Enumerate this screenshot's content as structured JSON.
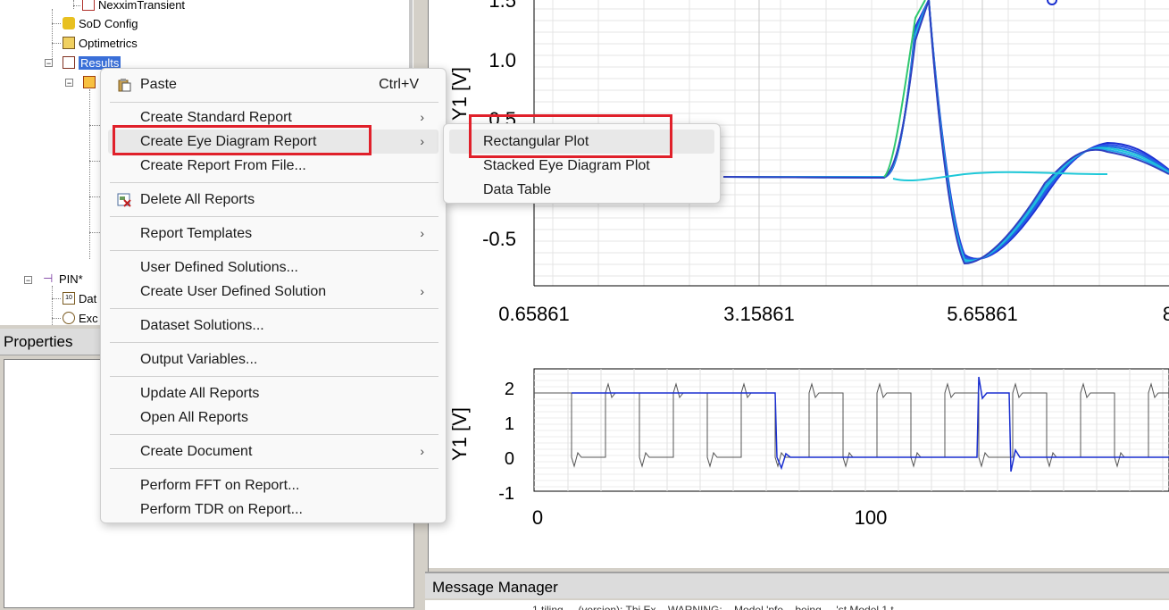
{
  "tree": {
    "items": [
      {
        "label": "NexximTransient"
      },
      {
        "label": "SoD Config"
      },
      {
        "label": "Optimetrics"
      },
      {
        "label": "Results"
      },
      {
        "label": "PIN*"
      },
      {
        "label": "Dat"
      },
      {
        "label": "Exc"
      }
    ]
  },
  "properties": {
    "title": "Properties"
  },
  "message_manager": {
    "title": "Message Manager",
    "text": "...1 tiling ... (version): Thi Ex ...WARNING: ...Model 'pfe... being ... 'st Model 1 t..."
  },
  "context_menu": {
    "items": [
      {
        "label": "Paste",
        "shortcut": "Ctrl+V",
        "icon": "paste-icon"
      },
      {
        "label": "Create Standard Report",
        "submenu": true
      },
      {
        "label": "Create Eye Diagram Report",
        "submenu": true
      },
      {
        "label": "Create Report From File..."
      },
      {
        "label": "Delete All Reports",
        "icon": "delete-reports-icon"
      },
      {
        "label": "Report Templates",
        "submenu": true
      },
      {
        "label": "User Defined Solutions..."
      },
      {
        "label": "Create User Defined Solution",
        "submenu": true
      },
      {
        "label": "Dataset Solutions..."
      },
      {
        "label": "Output Variables..."
      },
      {
        "label": "Update All Reports"
      },
      {
        "label": "Open All Reports"
      },
      {
        "label": "Create Document",
        "submenu": true
      },
      {
        "label": "Perform FFT on Report..."
      },
      {
        "label": "Perform TDR on Report..."
      }
    ],
    "arrow": "›"
  },
  "submenu": {
    "items": [
      {
        "label": "Rectangular Plot"
      },
      {
        "label": "Stacked Eye Diagram Plot"
      },
      {
        "label": "Data Table"
      }
    ]
  },
  "colors": {
    "highlight_box": "#e0202a",
    "menu_bg": "#f9f9f9",
    "trace_blue": "#1a2fd0",
    "trace_cyan": "#1ec8d8",
    "trace_gray": "#555555"
  },
  "chart_data": [
    {
      "type": "line",
      "title": "",
      "ylabel": "Y1 [V]",
      "xlabel": "",
      "y_ticks": [
        "1.5",
        "1.0",
        "0.5",
        "-0.5"
      ],
      "x_ticks": [
        "0.65861",
        "3.15861",
        "5.65861",
        "8"
      ],
      "ylim": [
        -0.8,
        1.5
      ],
      "grid": true,
      "series": [
        {
          "values_x": [
            0.65861,
            3.0,
            4.6,
            5.0,
            5.4,
            5.8,
            6.4,
            7.0,
            7.6,
            8.2
          ],
          "values_y": [
            0.0,
            0.0,
            0.0,
            1.5,
            0.0,
            -0.75,
            -0.55,
            0.3,
            0.35,
            0.1
          ]
        }
      ]
    },
    {
      "type": "line",
      "title": "",
      "ylabel": "Y1 [V]",
      "xlabel": "",
      "y_ticks": [
        "2",
        "1",
        "0",
        "-1"
      ],
      "x_ticks": [
        "0",
        "100"
      ],
      "ylim": [
        -1,
        2.5
      ],
      "grid": true
    }
  ]
}
